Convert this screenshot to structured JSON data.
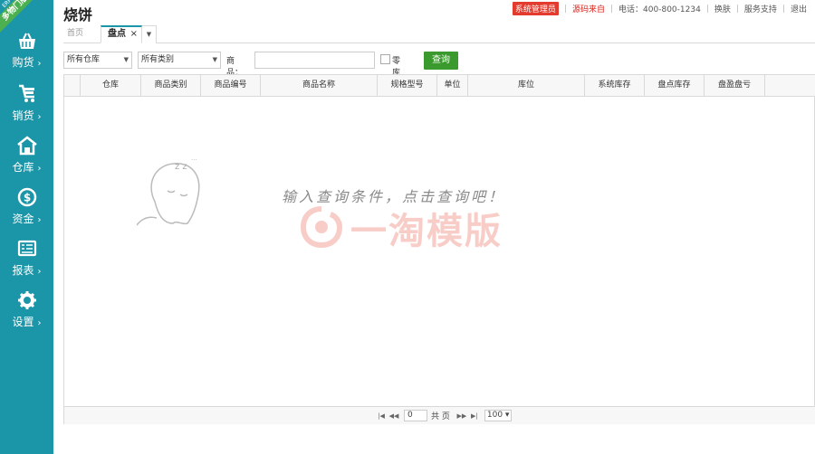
{
  "ribbon": {
    "main": "多物门版",
    "small": "ERP"
  },
  "sidebar": {
    "items": [
      {
        "label": "购货",
        "icon": "basket-icon"
      },
      {
        "label": "销货",
        "icon": "cart-icon"
      },
      {
        "label": "仓库",
        "icon": "warehouse-icon"
      },
      {
        "label": "资金",
        "icon": "dollar-icon"
      },
      {
        "label": "报表",
        "icon": "report-icon"
      },
      {
        "label": "设置",
        "icon": "gear-icon"
      }
    ],
    "chevron": "›"
  },
  "header": {
    "shop_name": "烧饼",
    "admin_badge": "系统管理员",
    "source_link": "源码来自",
    "phone": "电话：400-800-1234",
    "switch_skin": "换肤",
    "support": "服务支持",
    "logout": "退出"
  },
  "tabs": {
    "home": "首页",
    "active": "盘点",
    "close": "×",
    "more": "▼"
  },
  "filters": {
    "warehouse_select": "所有仓库",
    "category_select": "所有类别",
    "goods_label": "商品：",
    "goods_value": "",
    "zero_stock_label": "零库存",
    "query_button": "查询"
  },
  "table": {
    "columns": [
      "仓库",
      "商品类别",
      "商品编号",
      "商品名称",
      "规格型号",
      "单位",
      "库位",
      "系统库存",
      "盘点库存",
      "盘盈盘亏"
    ]
  },
  "empty_state": {
    "message": "输入查询条件，点击查询吧！",
    "sleep_text": "z z ..."
  },
  "watermark": {
    "text": "一淘模版"
  },
  "pager": {
    "first": "|◀",
    "prev": "◀◀",
    "page_value": "0",
    "total_label": "共 页",
    "next": "▶▶",
    "last": "▶|",
    "page_size": "100"
  }
}
